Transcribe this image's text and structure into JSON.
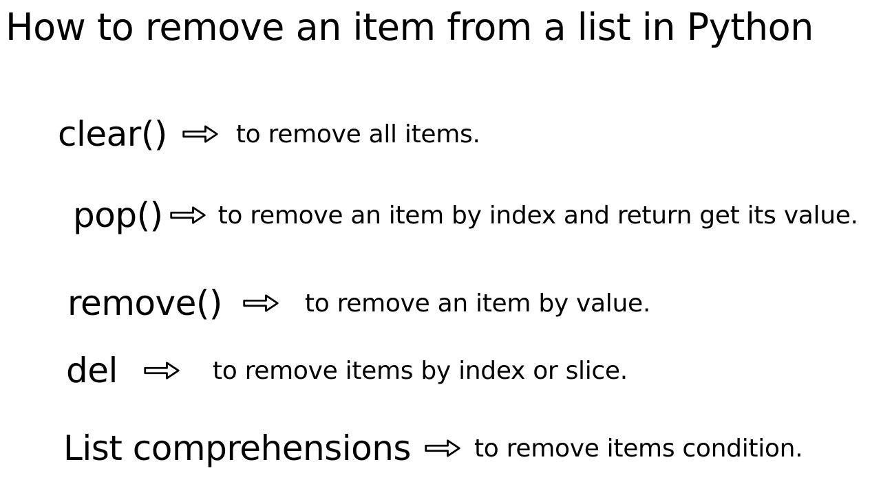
{
  "title": "How to remove an item from a list in Python",
  "rows": [
    {
      "method": "clear()",
      "desc": "to remove all items."
    },
    {
      "method": "pop()",
      "desc": "to remove an item by index and return get its value."
    },
    {
      "method": "remove()",
      "desc": "to remove an item by value."
    },
    {
      "method": "del",
      "desc": "to remove items by index or slice."
    },
    {
      "method": "List comprehensions",
      "desc": "to remove items condition."
    }
  ]
}
